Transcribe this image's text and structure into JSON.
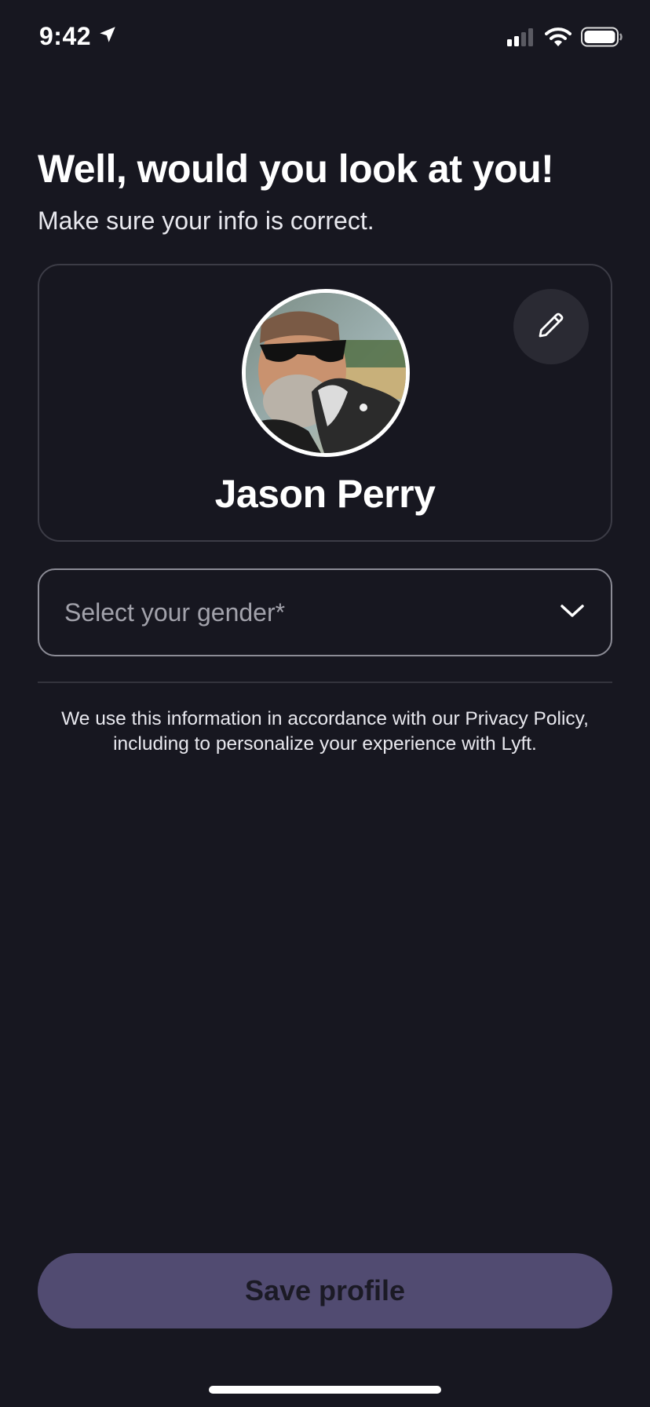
{
  "status_bar": {
    "time": "9:42",
    "icons": [
      "location-arrow-icon",
      "cellular-signal-icon",
      "wifi-icon",
      "battery-icon"
    ]
  },
  "header": {
    "title": "Well, would you look at you!",
    "subtitle": "Make sure your info is correct."
  },
  "profile": {
    "name": "Jason Perry",
    "edit_icon": "pencil-icon"
  },
  "gender": {
    "placeholder": "Select your gender*",
    "icon": "chevron-down-icon"
  },
  "privacy": {
    "text": "We use this information in accordance with our Privacy Policy, including to personalize your experience with Lyft."
  },
  "actions": {
    "save_label": "Save profile"
  },
  "colors": {
    "background": "#171720",
    "save_button": "#514b71",
    "card_border": "#3c3c46"
  }
}
